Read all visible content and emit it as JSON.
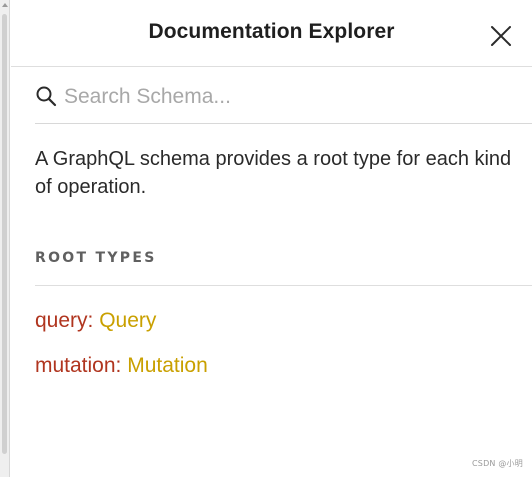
{
  "header": {
    "title": "Documentation Explorer",
    "close_icon": "close-icon"
  },
  "search": {
    "placeholder": "Search Schema...",
    "value": "",
    "icon": "search-icon"
  },
  "description": "A GraphQL schema provides a root type for each kind of operation.",
  "root_types": {
    "heading": "ROOT TYPES",
    "items": [
      {
        "field": "query",
        "separator": ":",
        "type": "Query"
      },
      {
        "field": "mutation",
        "separator": ":",
        "type": "Mutation"
      }
    ]
  },
  "colors": {
    "field_name": "#b0351f",
    "type_name": "#c9a000",
    "heading": "#606060"
  },
  "watermark": "CSDN @小明"
}
